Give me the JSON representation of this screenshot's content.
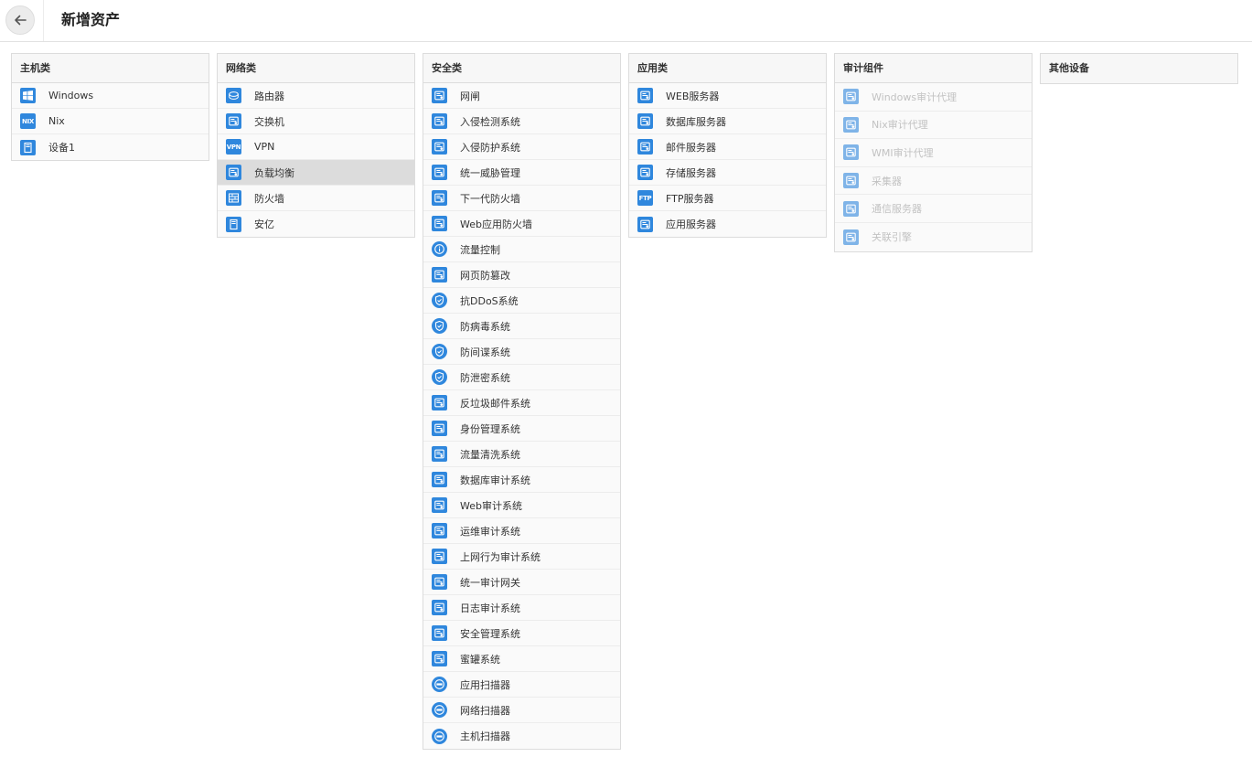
{
  "header": {
    "title": "新增资产"
  },
  "panels": {
    "host": {
      "title": "主机类",
      "items": [
        {
          "label": "Windows",
          "icon": "windows-icon"
        },
        {
          "label": "Nix",
          "icon": "nix-icon",
          "badge": "NIX"
        },
        {
          "label": "设备1",
          "icon": "device-icon"
        }
      ]
    },
    "network": {
      "title": "网络类",
      "items": [
        {
          "label": "路由器",
          "icon": "router-icon"
        },
        {
          "label": "交换机",
          "icon": "switch-icon"
        },
        {
          "label": "VPN",
          "icon": "vpn-icon",
          "badge": "VPN"
        },
        {
          "label": "负载均衡",
          "icon": "load-balancer-icon",
          "selected": true
        },
        {
          "label": "防火墙",
          "icon": "firewall-icon"
        },
        {
          "label": "安亿",
          "icon": "device-icon"
        }
      ]
    },
    "security": {
      "title": "安全类",
      "items": [
        {
          "label": "网闸",
          "icon": "gateway-icon"
        },
        {
          "label": "入侵检测系统",
          "icon": "ids-icon"
        },
        {
          "label": "入侵防护系统",
          "icon": "ips-icon"
        },
        {
          "label": "统一威胁管理",
          "icon": "utm-icon"
        },
        {
          "label": "下一代防火墙",
          "icon": "ngfw-icon"
        },
        {
          "label": "Web应用防火墙",
          "icon": "waf-icon"
        },
        {
          "label": "流量控制",
          "icon": "info-icon"
        },
        {
          "label": "网页防篡改",
          "icon": "web-tamper-icon"
        },
        {
          "label": "抗DDoS系统",
          "icon": "shield-icon"
        },
        {
          "label": "防病毒系统",
          "icon": "shield-icon"
        },
        {
          "label": "防间谍系统",
          "icon": "shield-icon"
        },
        {
          "label": "防泄密系统",
          "icon": "shield-icon"
        },
        {
          "label": "反垃圾邮件系统",
          "icon": "mail-icon"
        },
        {
          "label": "身份管理系统",
          "icon": "identity-icon"
        },
        {
          "label": "流量清洗系统",
          "icon": "traffic-icon"
        },
        {
          "label": "数据库审计系统",
          "icon": "database-audit-icon"
        },
        {
          "label": "Web审计系统",
          "icon": "web-audit-icon"
        },
        {
          "label": "运维审计系统",
          "icon": "ops-audit-icon"
        },
        {
          "label": "上网行为审计系统",
          "icon": "behavior-audit-icon"
        },
        {
          "label": "统一审计网关",
          "icon": "audit-gateway-icon"
        },
        {
          "label": "日志审计系统",
          "icon": "log-audit-icon"
        },
        {
          "label": "安全管理系统",
          "icon": "security-mgmt-icon"
        },
        {
          "label": "蜜罐系统",
          "icon": "honeypot-icon"
        },
        {
          "label": "应用扫描器",
          "icon": "scanner-icon"
        },
        {
          "label": "网络扫描器",
          "icon": "scanner-icon"
        },
        {
          "label": "主机扫描器",
          "icon": "scanner-icon"
        }
      ]
    },
    "application": {
      "title": "应用类",
      "items": [
        {
          "label": "WEB服务器",
          "icon": "web-server-icon"
        },
        {
          "label": "数据库服务器",
          "icon": "database-server-icon"
        },
        {
          "label": "邮件服务器",
          "icon": "mail-server-icon"
        },
        {
          "label": "存储服务器",
          "icon": "storage-server-icon"
        },
        {
          "label": "FTP服务器",
          "icon": "ftp-server-icon",
          "badge": "FTP"
        },
        {
          "label": "应用服务器",
          "icon": "app-server-icon"
        }
      ]
    },
    "audit": {
      "title": "审计组件",
      "items": [
        {
          "label": "Windows审计代理",
          "icon": "windows-agent-icon"
        },
        {
          "label": "Nix审计代理",
          "icon": "nix-agent-icon"
        },
        {
          "label": "WMI审计代理",
          "icon": "wmi-agent-icon"
        },
        {
          "label": "采集器",
          "icon": "collector-icon"
        },
        {
          "label": "通信服务器",
          "icon": "comm-server-icon"
        },
        {
          "label": "关联引擎",
          "icon": "engine-icon"
        }
      ]
    },
    "other": {
      "title": "其他设备",
      "items": []
    }
  },
  "colors": {
    "icon_blue": "#2f87dd",
    "selected_bg": "#dcdcdc",
    "disabled_text": "#c2c2c2"
  }
}
